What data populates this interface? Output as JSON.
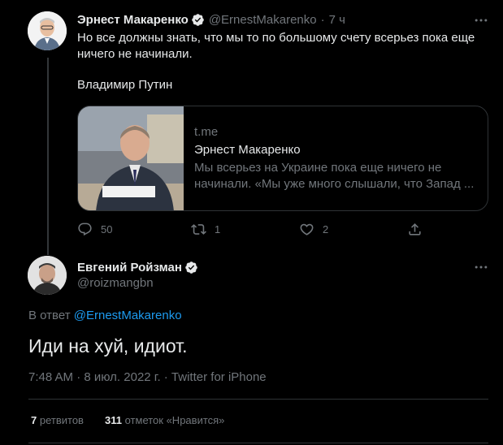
{
  "tweet1": {
    "author_name": "Эрнест Макаренко",
    "handle": "@ErnestMakarenko",
    "separator": "·",
    "time": "7 ч",
    "text_line1": "Но все должны знать, что мы то по большому счету всерьез пока еще",
    "text_line2": "ничего не начинали.",
    "signature": "Владимир Путин",
    "card": {
      "domain": "t.me",
      "title": "Эрнест Макаренко",
      "desc_line1": "Мы всерьез на Украине пока еще ничего не",
      "desc_line2": "начинали. «Мы уже много слышали, что Запад ..."
    },
    "actions": {
      "reply_count": "50",
      "retweet_count": "1",
      "like_count": "2"
    }
  },
  "tweet2": {
    "author_name": "Евгений Ройзман",
    "handle": "@roizmangbn",
    "reply_prefix": "В ответ",
    "reply_to": "@ErnestMakarenko",
    "text": "Иди на хуй, идиот.",
    "meta": "7:48 AM · 8 июл. 2022 г. · Twitter for iPhone",
    "stats": {
      "retweets_count": "7",
      "retweets_label": "ретвитов",
      "likes_count": "311",
      "likes_label": "отметок «Нравится»"
    }
  },
  "colors": {
    "background": "#000000",
    "text": "#e7e9ea",
    "muted": "#71767b",
    "link": "#1d9bf0",
    "divider": "#2f3336"
  },
  "icons": [
    "more-icon",
    "verified-badge-icon",
    "reply-icon",
    "retweet-icon",
    "like-icon",
    "share-icon"
  ]
}
